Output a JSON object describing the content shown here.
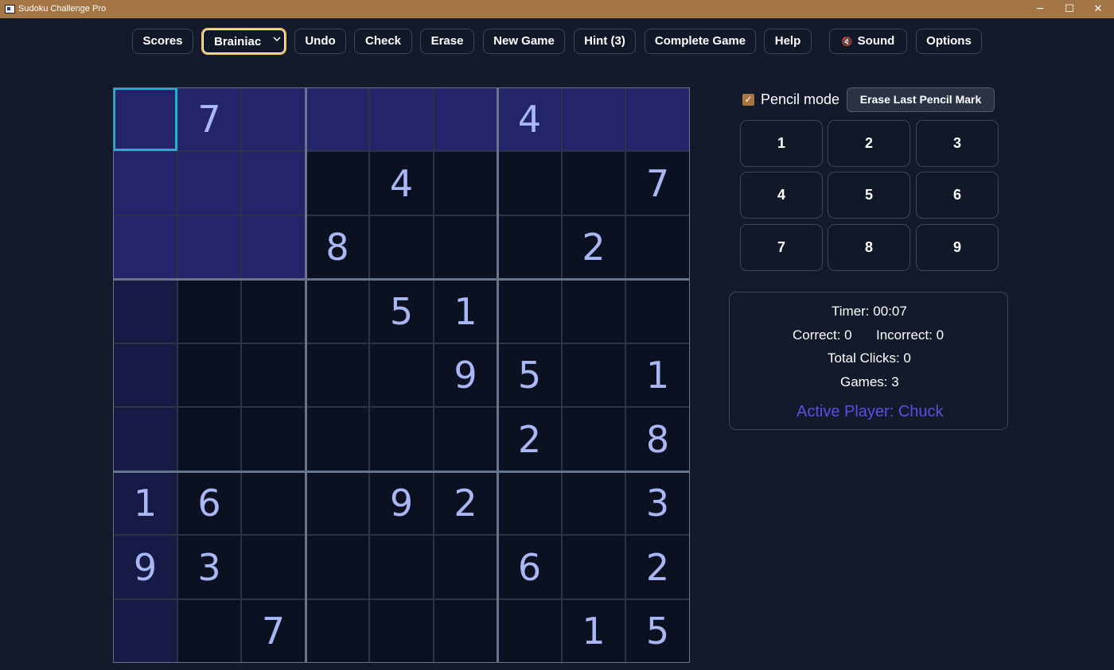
{
  "window": {
    "title": "Sudoku Challenge Pro",
    "controls": {
      "minimize": "─",
      "maximize": "☐",
      "close": "✕"
    }
  },
  "toolbar": {
    "scores": "Scores",
    "difficulty": "Brainiac",
    "undo": "Undo",
    "check": "Check",
    "erase": "Erase",
    "new_game": "New Game",
    "hint": "Hint (3)",
    "complete_game": "Complete Game",
    "help": "Help",
    "sound": "Sound",
    "options": "Options"
  },
  "board": {
    "selected": [
      0,
      0
    ],
    "grid": [
      [
        "",
        "7",
        "",
        "",
        "",
        "",
        "4",
        "",
        ""
      ],
      [
        "",
        "",
        "",
        "",
        "4",
        "",
        "",
        "",
        "7"
      ],
      [
        "",
        "",
        "",
        "8",
        "",
        "",
        "",
        "2",
        ""
      ],
      [
        "",
        "",
        "",
        "",
        "5",
        "1",
        "",
        "",
        ""
      ],
      [
        "",
        "",
        "",
        "",
        "",
        "9",
        "5",
        "",
        "1"
      ],
      [
        "",
        "",
        "",
        "",
        "",
        "",
        "2",
        "",
        "8"
      ],
      [
        "1",
        "6",
        "",
        "",
        "9",
        "2",
        "",
        "",
        "3"
      ],
      [
        "9",
        "3",
        "",
        "",
        "",
        "",
        "6",
        "",
        "2"
      ],
      [
        "",
        "",
        "7",
        "",
        "",
        "",
        "",
        "1",
        "5"
      ]
    ]
  },
  "pencil": {
    "checked": true,
    "label": "Pencil mode",
    "erase_last": "Erase Last Pencil Mark"
  },
  "numpad": [
    "1",
    "2",
    "3",
    "4",
    "5",
    "6",
    "7",
    "8",
    "9"
  ],
  "stats": {
    "timer": "Timer: 00:07",
    "correct": "Correct: 0",
    "incorrect": "Incorrect: 0",
    "total_clicks": "Total Clicks: 0",
    "games": "Games: 3",
    "active_player": "Active Player: Chuck"
  },
  "colors": {
    "accent_border": "#f2c15b",
    "selected_cell": "#19b3d9",
    "active_player": "#5b4ee8",
    "digit": "#a9b7f5"
  }
}
